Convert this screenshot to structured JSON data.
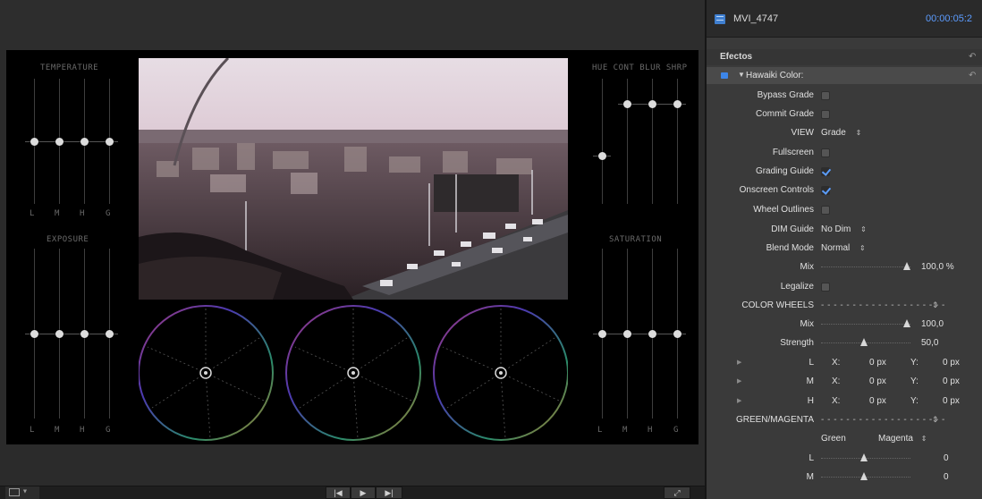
{
  "viewer": {
    "temperature_title": "TEMPERATURE",
    "exposure_title": "EXPOSURE",
    "hcbs_title": "HUE CONT BLUR SHRP",
    "saturation_title": "SATURATION",
    "lmhg": [
      "L",
      "M",
      "H",
      "G"
    ],
    "temperature_levels": [
      0.5,
      0.5,
      0.5,
      0.5
    ],
    "exposure_levels": [
      0.5,
      0.5,
      0.5,
      0.5
    ],
    "hcbs_levels": [
      0.38,
      0.82,
      0.82,
      0.82
    ],
    "saturation_levels": [
      0.5,
      0.5,
      0.5,
      0.5
    ]
  },
  "inspector": {
    "clip_name": "MVI_4747",
    "timecode": "00:00:05:2",
    "effects_label": "Efectos",
    "effect_name": "Hawaiki Color:",
    "params": {
      "bypass_grade": {
        "label": "Bypass Grade",
        "checked": false
      },
      "commit_grade": {
        "label": "Commit Grade",
        "checked": false
      },
      "view": {
        "label": "VIEW",
        "value": "Grade"
      },
      "fullscreen": {
        "label": "Fullscreen",
        "checked": false
      },
      "grading_guide": {
        "label": "Grading Guide",
        "checked": true
      },
      "onscreen_controls": {
        "label": "Onscreen Controls",
        "checked": true
      },
      "wheel_outlines": {
        "label": "Wheel Outlines",
        "checked": false
      },
      "dim_guide": {
        "label": "DIM Guide",
        "value": "No Dim"
      },
      "blend_mode": {
        "label": "Blend Mode",
        "value": "Normal"
      },
      "mix": {
        "label": "Mix",
        "value": "100,0 %",
        "level": 1.0
      },
      "legalize": {
        "label": "Legalize",
        "checked": false
      },
      "color_wheels": {
        "label": "COLOR WHEELS",
        "dashes": "- - - - - - - - - - - - - - - - - - - -"
      },
      "wheels_mix": {
        "label": "Mix",
        "value": "100,0",
        "level": 1.0
      },
      "strength": {
        "label": "Strength",
        "value": "50,0",
        "level": 0.5
      },
      "wheel_l": {
        "label": "L",
        "x_label": "X:",
        "x_value": "0 px",
        "y_label": "Y:",
        "y_value": "0 px"
      },
      "wheel_m": {
        "label": "M",
        "x_label": "X:",
        "x_value": "0 px",
        "y_label": "Y:",
        "y_value": "0 px"
      },
      "wheel_h": {
        "label": "H",
        "x_label": "X:",
        "x_value": "0 px",
        "y_label": "Y:",
        "y_value": "0 px"
      },
      "green_magenta": {
        "label": "GREEN/MAGENTA",
        "dashes": "- - - - - - - - - - - - - - - - - - - -",
        "green": "Green",
        "magenta": "Magenta"
      },
      "gm_l": {
        "label": "L",
        "value": "0",
        "level": 0.5
      },
      "gm_m": {
        "label": "M",
        "value": "0",
        "level": 0.5
      }
    }
  },
  "colors": {
    "accent_blue": "#5c9cff",
    "panel_bg": "#3a3a3a",
    "viewer_bg": "#000000"
  }
}
